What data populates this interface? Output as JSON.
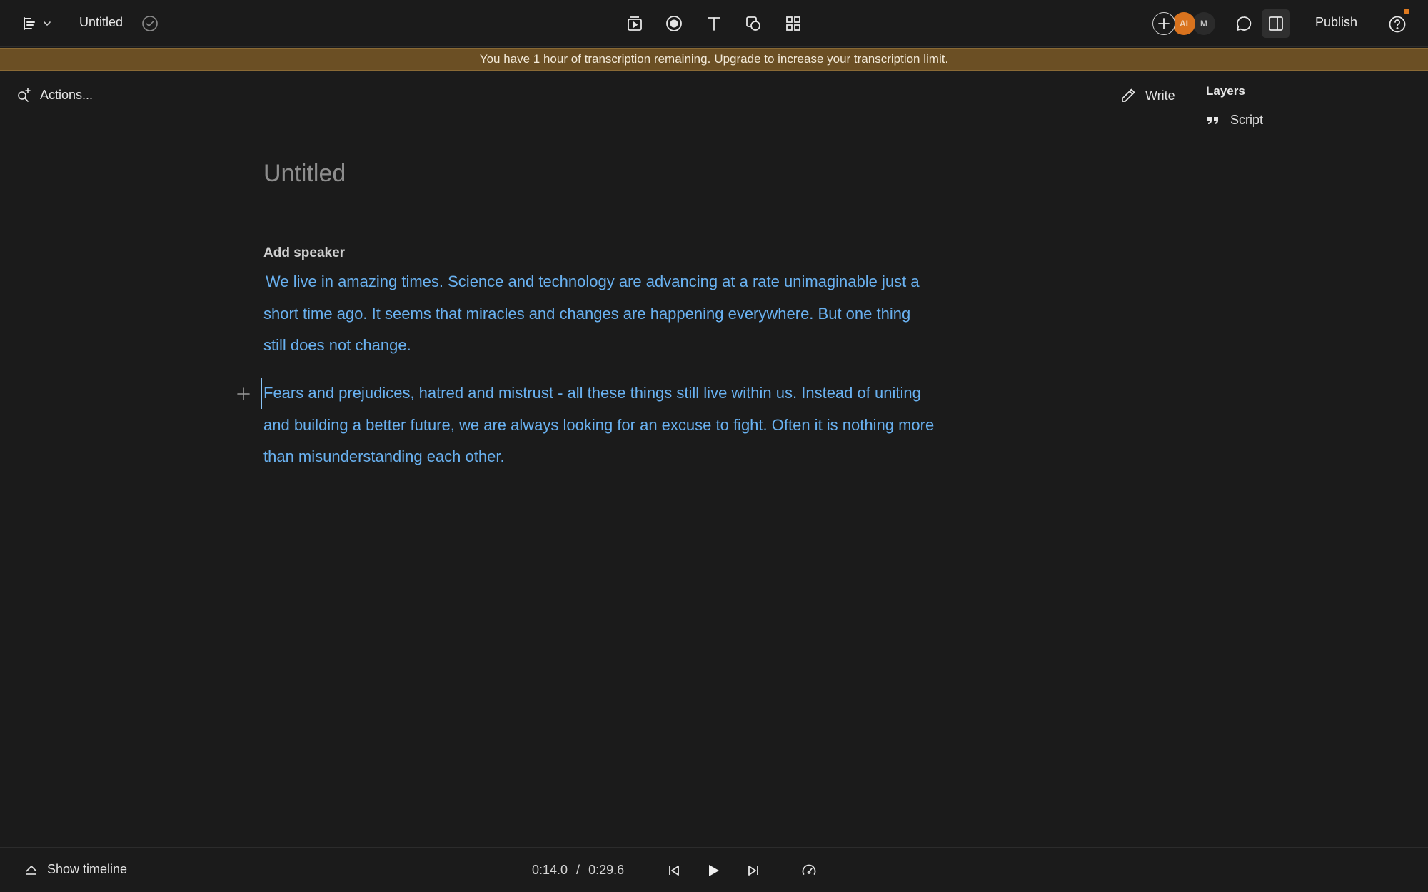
{
  "header": {
    "doc_title": "Untitled",
    "publish_label": "Publish",
    "avatars": [
      "AI",
      "M"
    ],
    "accent_color": "#e07a1f"
  },
  "banner": {
    "message": "You have 1 hour of transcription remaining.",
    "link_text": "Upgrade to increase your transcription limit",
    "trailing": ".",
    "background": "#6b4f24"
  },
  "editor": {
    "actions_label": "Actions...",
    "write_label": "Write",
    "title": "Untitled",
    "speaker_label": "Add speaker",
    "paragraphs": [
      "We live in amazing times. Science and technology are advancing at a rate unimaginable just a short time ago. It seems that miracles and changes are happening everywhere. But one thing still does not change.",
      "Fears and prejudices, hatred and mistrust - all these things still live within us. Instead of uniting and building a better future, we are always looking for an excuse to fight. Often it is nothing more than misunderstanding each other."
    ],
    "text_color": "#69b1f0"
  },
  "layers": {
    "title": "Layers",
    "items": [
      {
        "label": "Script",
        "icon": "quote-icon"
      }
    ]
  },
  "playback": {
    "show_timeline_label": "Show timeline",
    "current_time": "0:14.0",
    "separator": "/",
    "total_time": "0:29.6"
  }
}
